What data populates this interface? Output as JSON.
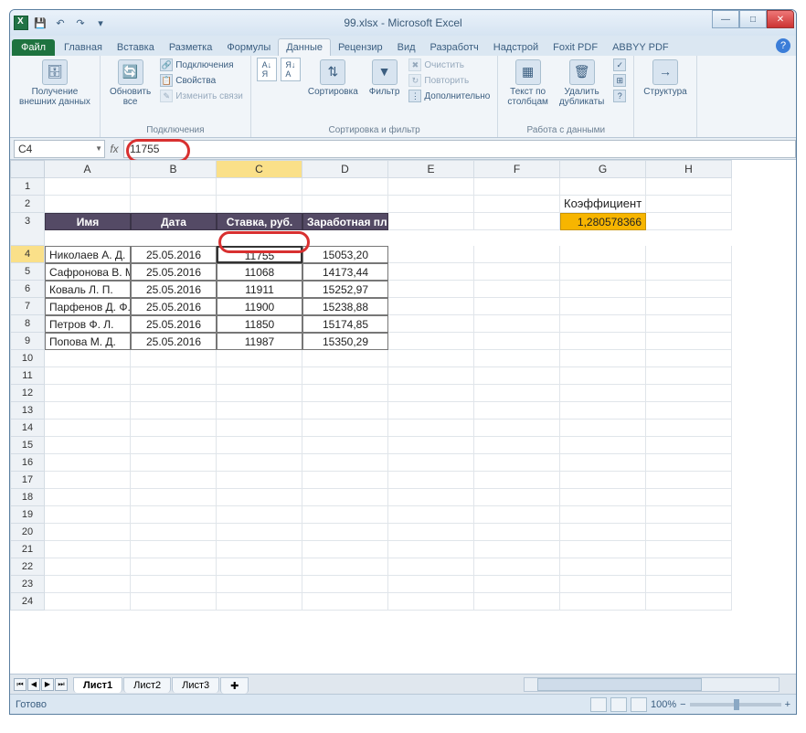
{
  "title": "99.xlsx - Microsoft Excel",
  "qat": {
    "save": "💾",
    "undo": "↶",
    "redo": "↷"
  },
  "tabs": {
    "file": "Файл",
    "items": [
      "Главная",
      "Вставка",
      "Разметка",
      "Формулы",
      "Данные",
      "Рецензир",
      "Вид",
      "Разработч",
      "Надстрой",
      "Foxit PDF",
      "ABBYY PDF"
    ],
    "active": "Данные"
  },
  "ribbon": {
    "g1": {
      "btn": "Получение\nвнешних данных",
      "label": ""
    },
    "g2": {
      "btn": "Обновить\nвсе",
      "items": [
        "Подключения",
        "Свойства",
        "Изменить связи"
      ],
      "label": "Подключения"
    },
    "g3": {
      "sort": "Сортировка",
      "filter": "Фильтр",
      "items": [
        "Очистить",
        "Повторить",
        "Дополнительно"
      ],
      "label": "Сортировка и фильтр"
    },
    "g4": {
      "btn1": "Текст по\nстолбцам",
      "btn2": "Удалить\nдубликаты",
      "label": "Работа с данными"
    },
    "g5": {
      "btn": "Структура"
    }
  },
  "namebox": "C4",
  "formula": "11755",
  "columns": [
    "A",
    "B",
    "C",
    "D",
    "E",
    "F",
    "G",
    "H"
  ],
  "headers": {
    "name": "Имя",
    "date": "Дата",
    "rate": "Ставка, руб.",
    "salary": "Заработная плата"
  },
  "koef": {
    "head": "Коэффициент",
    "val": "1,280578366"
  },
  "table": {
    "rows": [
      {
        "name": "Николаев А. Д.",
        "date": "25.05.2016",
        "rate": "11755",
        "salary": "15053,20"
      },
      {
        "name": "Сафронова В. М.",
        "date": "25.05.2016",
        "rate": "11068",
        "salary": "14173,44"
      },
      {
        "name": "Коваль Л. П.",
        "date": "25.05.2016",
        "rate": "11911",
        "salary": "15252,97"
      },
      {
        "name": "Парфенов Д. Ф.",
        "date": "25.05.2016",
        "rate": "11900",
        "salary": "15238,88"
      },
      {
        "name": "Петров Ф. Л.",
        "date": "25.05.2016",
        "rate": "11850",
        "salary": "15174,85"
      },
      {
        "name": "Попова М. Д.",
        "date": "25.05.2016",
        "rate": "11987",
        "salary": "15350,29"
      }
    ]
  },
  "sheets": {
    "active": "Лист1",
    "others": [
      "Лист2",
      "Лист3"
    ]
  },
  "status": {
    "ready": "Готово",
    "zoom": "100%"
  }
}
